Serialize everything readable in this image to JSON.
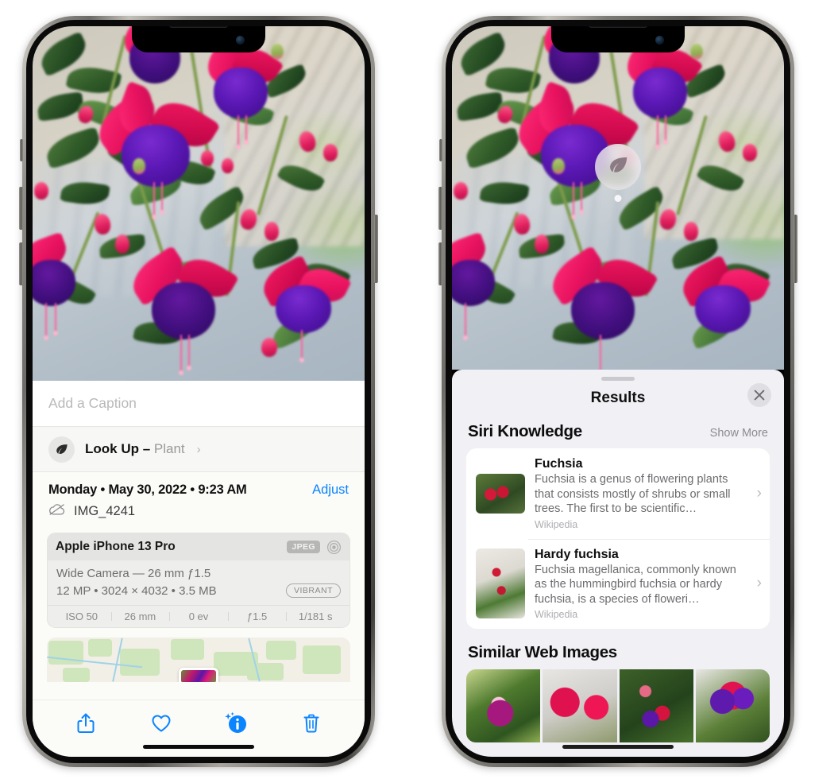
{
  "left_phone": {
    "photo": {
      "alt": "fuchsia-flowers-photo"
    },
    "caption": {
      "placeholder": "Add a Caption",
      "value": ""
    },
    "lookup": {
      "icon": "leaf-icon",
      "label": "Look Up – ",
      "subject": "Plant",
      "chevron": "›"
    },
    "metadata": {
      "date": "Monday • May 30, 2022 • 9:23 AM",
      "adjust_label": "Adjust",
      "cloud_icon": "icloud-slash-icon",
      "filename": "IMG_4241"
    },
    "exif": {
      "device": "Apple iPhone 13 Pro",
      "format_badge": "JPEG",
      "lens_icon": "aperture-icon",
      "lens_line": "Wide Camera — 26 mm ƒ1.5",
      "size_line": "12 MP • 3024 × 4032 • 3.5 MB",
      "style_badge": "VIBRANT",
      "stats": [
        "ISO 50",
        "26 mm",
        "0 ev",
        "ƒ1.5",
        "1/181 s"
      ]
    },
    "map": {
      "pin": "photo-thumbnail-pin"
    },
    "toolbar": [
      {
        "name": "share-button",
        "icon": "share-icon"
      },
      {
        "name": "favorite-button",
        "icon": "heart-icon"
      },
      {
        "name": "info-button",
        "icon": "info-sparkle-icon"
      },
      {
        "name": "delete-button",
        "icon": "trash-icon"
      }
    ]
  },
  "right_phone": {
    "photo": {
      "alt": "fuchsia-flowers-photo"
    },
    "detect_badge": {
      "icon": "leaf-icon"
    },
    "sheet": {
      "title": "Results",
      "close_label": "✕",
      "siri_section": {
        "title": "Siri Knowledge",
        "show_more": "Show More",
        "items": [
          {
            "title": "Fuchsia",
            "description": "Fuchsia is a genus of flowering plants that consists mostly of shrubs or small trees. The first to be scientific…",
            "source": "Wikipedia",
            "chevron": "›"
          },
          {
            "title": "Hardy fuchsia",
            "description": "Fuchsia magellanica, commonly known as the hummingbird fuchsia or hardy fuchsia, is a species of floweri…",
            "source": "Wikipedia",
            "chevron": "›"
          }
        ]
      },
      "web_section": {
        "title": "Similar Web Images",
        "images": [
          {
            "name": "web-image-1"
          },
          {
            "name": "web-image-2"
          },
          {
            "name": "web-image-3"
          },
          {
            "name": "web-image-4"
          }
        ]
      }
    }
  },
  "colors": {
    "accent_blue": "#0a84ff",
    "sheet_bg": "#f1f0f5",
    "card_bg": "#ffffff",
    "info_bg": "#fbfbf8"
  }
}
